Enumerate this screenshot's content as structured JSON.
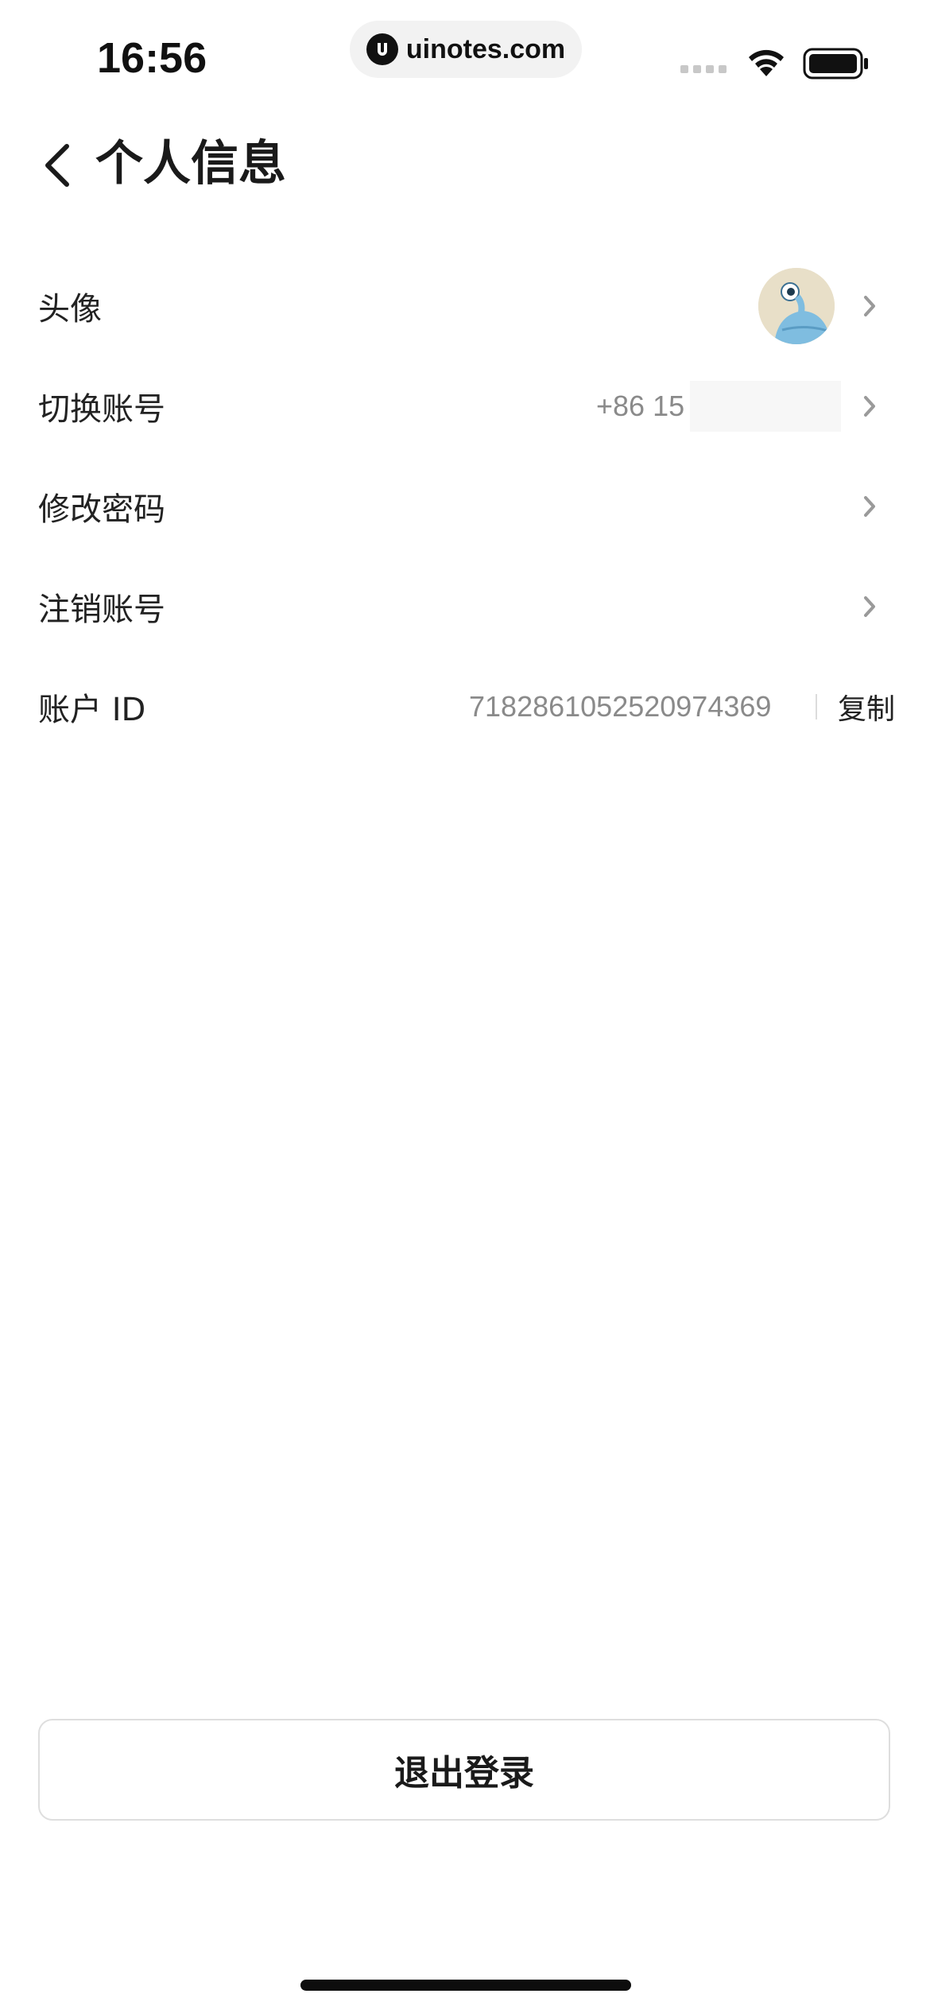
{
  "status_bar": {
    "time": "16:56",
    "url": "uinotes.com",
    "icons": [
      "cellular-signal-icon",
      "wifi-icon",
      "battery-icon"
    ]
  },
  "header": {
    "back_icon": "chevron-left-icon",
    "title": "个人信息"
  },
  "rows": {
    "avatar": {
      "label": "头像"
    },
    "switch_account": {
      "label": "切换账号",
      "value": "+86 15"
    },
    "change_password": {
      "label": "修改密码"
    },
    "delete_account": {
      "label": "注销账号"
    },
    "account_id": {
      "label": "账户 ID",
      "value": "7182861052520974369",
      "action": "复制"
    }
  },
  "logout": {
    "label": "退出登录"
  },
  "colors": {
    "text_primary": "#1f1f1f",
    "text_secondary": "#8a8a8a",
    "border": "#dedede",
    "background": "#ffffff"
  }
}
